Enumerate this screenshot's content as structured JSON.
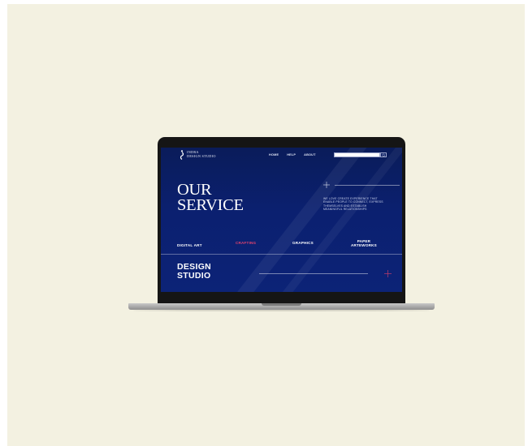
{
  "brand": {
    "name": "INDRA\nDESIGN STUDIO"
  },
  "nav": {
    "items": [
      {
        "label": "HOME"
      },
      {
        "label": "HELP"
      },
      {
        "label": "ABOUT"
      }
    ]
  },
  "search": {
    "value": "",
    "placeholder": ""
  },
  "hero": {
    "title": "OUR\nSERVICE",
    "description": "WE LOVE CREATE EXPERIENCE THAT ENABLE PEOPLE TO CONNECT, EXPRESS THEMSELVES AND ESTABLISH MEANINGFUL RELATIONSHIPS"
  },
  "services": [
    {
      "label": "DIGITAL ART",
      "active": false
    },
    {
      "label": "CRAFTING",
      "active": true
    },
    {
      "label": "GRAPHICS",
      "active": false
    },
    {
      "label": "PAPER\nARTEWORKS",
      "active": false
    }
  ],
  "studio": {
    "title": "DESIGN\nSTUDIO"
  },
  "colors": {
    "page_background": "#f3f1e1",
    "screen_background": "#0b2070",
    "accent": "#e0436d",
    "laptop_frame": "#151515",
    "laptop_base": "#a5a5a5"
  },
  "icons": {
    "logo": "brand-logo-icon",
    "search": "search-icon",
    "plus_top": "plus-icon",
    "plus_bottom": "plus-icon"
  }
}
